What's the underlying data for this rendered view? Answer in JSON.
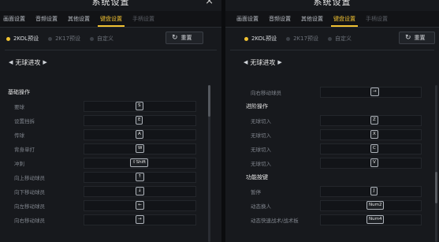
{
  "left": {
    "title": "系统设置",
    "close_icon": "×",
    "tabs": [
      "画面设置",
      "音频设置",
      "其他设置",
      "键盘设置",
      "手柄设置"
    ],
    "active_tab": 3,
    "presets": [
      "2KOL预设",
      "2K17预设",
      "自定义"
    ],
    "reset_label": "重置",
    "mode": {
      "prev": "◀",
      "label": "无球进攻",
      "next": "▶"
    },
    "section": "基础操作",
    "rows": [
      {
        "label": "要球",
        "key": "S"
      },
      {
        "label": "设置挡拆",
        "key": "E"
      },
      {
        "label": "传球",
        "key": "A"
      },
      {
        "label": "背身单打",
        "key": "W"
      },
      {
        "label": "冲刺",
        "key": "⇧Shift"
      },
      {
        "label": "向上移动球员",
        "key": "↑"
      },
      {
        "label": "向下移动球员",
        "key": "↓"
      },
      {
        "label": "向左移动球员",
        "key": "←"
      },
      {
        "label": "向右移动球员",
        "key": "→"
      }
    ]
  },
  "right": {
    "title": "系统设置",
    "tabs": [
      "画面设置",
      "音频设置",
      "其他设置",
      "键盘设置",
      "手柄设置"
    ],
    "active_tab": 3,
    "presets": [
      "2KOL预设",
      "2K17预设",
      "自定义"
    ],
    "reset_label": "重置",
    "mode": {
      "prev": "◀",
      "label": "无球进攻",
      "next": "▶"
    },
    "top_row": {
      "label": "向右移动球员",
      "key": "→"
    },
    "section1": "进阶操作",
    "rows1": [
      {
        "label": "无球切入",
        "key": "Z"
      },
      {
        "label": "无球切入",
        "key": "X"
      },
      {
        "label": "无球切入",
        "key": "C"
      },
      {
        "label": "无球切入",
        "key": "V"
      }
    ],
    "section2": "功能按键",
    "rows2": [
      {
        "label": "暂停",
        "key": "J"
      },
      {
        "label": "动态换人",
        "key": "Num2"
      },
      {
        "label": "动态快速战术/战术板",
        "key": "Num4"
      }
    ]
  }
}
